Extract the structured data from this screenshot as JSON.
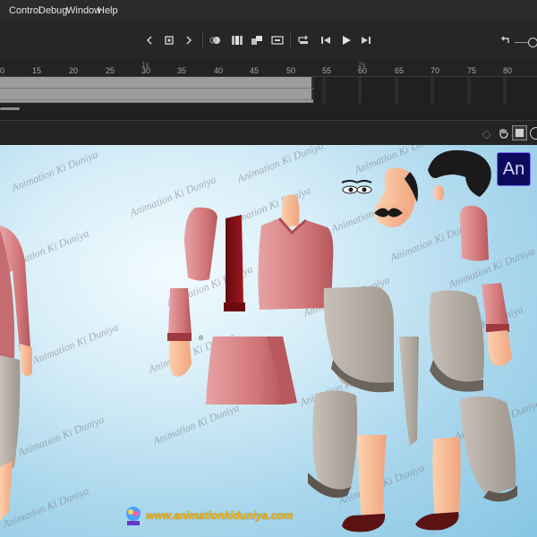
{
  "menubar": {
    "items": [
      "Control",
      "Debug",
      "Window",
      "Help"
    ]
  },
  "timeline": {
    "ruler_numbers": [
      "0",
      "15",
      "20",
      "25",
      "30",
      "35",
      "40",
      "45",
      "50",
      "55",
      "60",
      "65",
      "70",
      "75",
      "80"
    ],
    "ruler_marks": [
      "1s",
      "2s"
    ]
  },
  "stage": {
    "watermark_text": "Animation Ki Duniya",
    "footer_url": "www.animationkiduniya.com",
    "app_badge": "An"
  },
  "colors": {
    "shirt": "#d27c7f",
    "vest": "#8b0f16",
    "skin": "#f6b796",
    "dhoti": "#b3aba1",
    "hair": "#1a1a1a",
    "shoe": "#5b1313",
    "stage_bg": "#a9d6ec"
  }
}
